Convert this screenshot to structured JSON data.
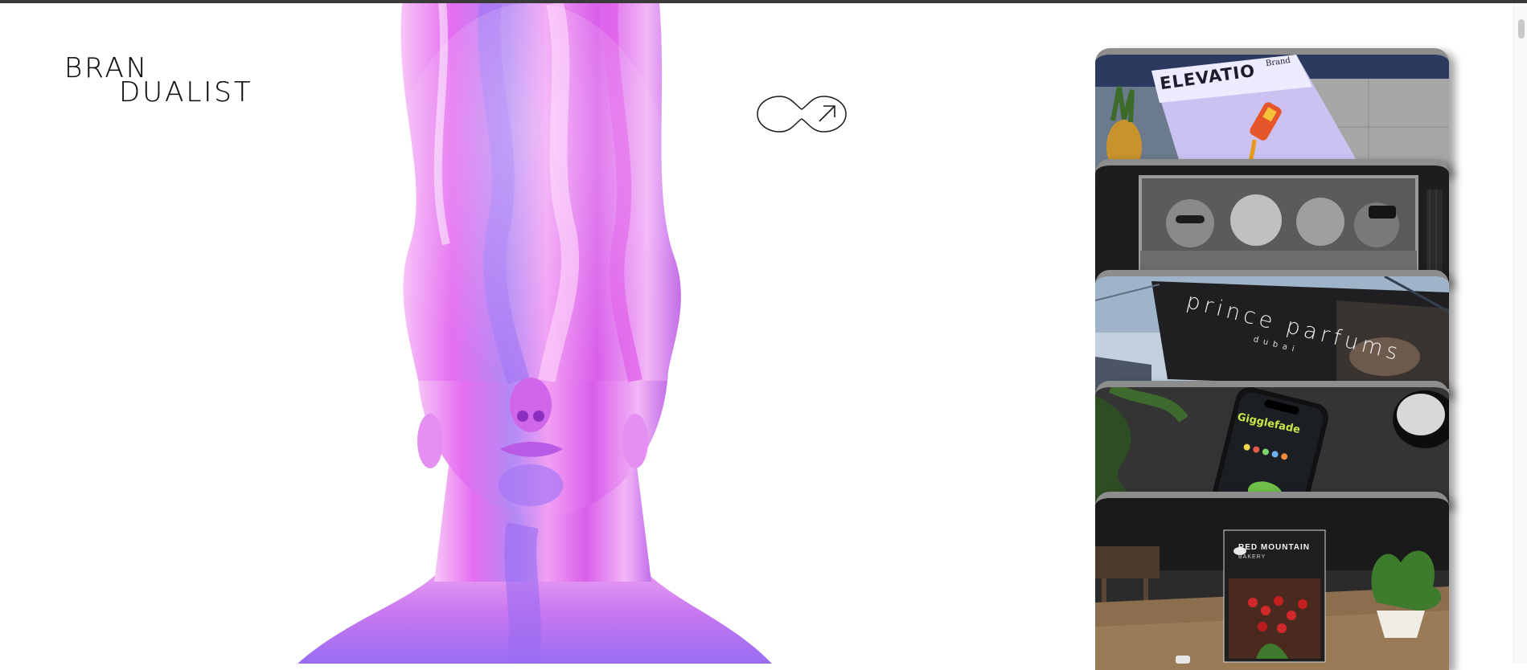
{
  "logo": {
    "line1": "BRAN",
    "line2": "DUALIST"
  },
  "cta": {
    "icon": "arrow-up-right-icon"
  },
  "projects": [
    {
      "name": "elevation",
      "text": "ELEVATIO",
      "subtext": "Brand"
    },
    {
      "name": "band-billboard",
      "text": ""
    },
    {
      "name": "prince-parfums",
      "text": "prince parfums",
      "subtext": "dubai"
    },
    {
      "name": "frog-app",
      "text": "Gigglefade"
    },
    {
      "name": "red-mountain",
      "text": "RED MOUNTAIN",
      "subtext": "BAKERY"
    }
  ],
  "colors": {
    "accent_pink": "#e276f0",
    "accent_violet": "#9a6cf2",
    "ink": "#111111"
  }
}
